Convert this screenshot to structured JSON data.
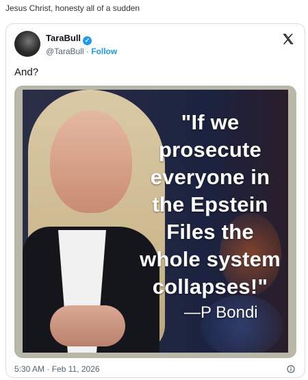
{
  "caption": "Jesus Christ, honesty all of a sudden",
  "tweet": {
    "display_name": "TaraBull",
    "handle": "@TaraBull",
    "separator": " · ",
    "follow_label": "Follow",
    "text": "And?",
    "timestamp": "5:30 AM · Feb 11, 2026"
  },
  "image": {
    "quote_lines": [
      "\"If we",
      "prosecute",
      "everyone in",
      "the Epstein",
      "Files the",
      "whole system",
      "collapses!\""
    ],
    "attribution": "—P Bondi"
  },
  "icons": {
    "verified": "verified-badge-icon",
    "brand": "x-logo-icon",
    "info": "info-icon"
  },
  "colors": {
    "accent": "#1d9bf0",
    "text": "#0f1419",
    "muted": "#536471"
  }
}
